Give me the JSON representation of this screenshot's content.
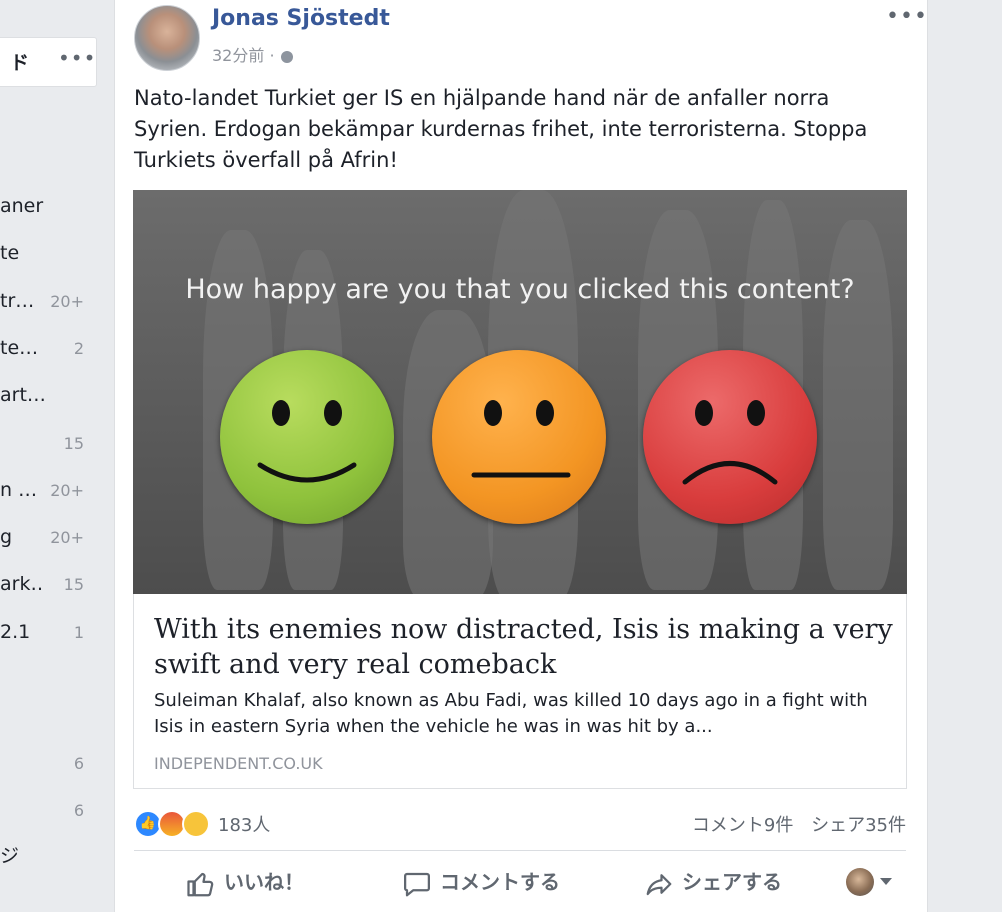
{
  "sidebar": {
    "top_label": "ド",
    "top_menu": "•••",
    "items": [
      {
        "label": "aner",
        "count": ""
      },
      {
        "label": "te",
        "count": ""
      },
      {
        "label": "tr…",
        "count": "20+"
      },
      {
        "label": "te…",
        "count": "2"
      },
      {
        "label": "art…",
        "count": ""
      },
      {
        "label": "",
        "count": "15"
      },
      {
        "label": "n …",
        "count": "20+"
      },
      {
        "label": "g",
        "count": "20+"
      },
      {
        "label": "ark…",
        "count": "15"
      },
      {
        "label": "2.1",
        "count": "1"
      },
      {
        "label": "",
        "count": "6"
      },
      {
        "label": "",
        "count": "6"
      },
      {
        "label": "ジ",
        "count": ""
      }
    ]
  },
  "post": {
    "author": "Jonas Sjöstedt",
    "time": "32分前 ·",
    "menu": "•••",
    "text": "Nato-landet Turkiet ger IS en hjälpande hand när de anfaller norra Syrien. Erdogan bekämpar kurdernas frihet, inte terroristerna. Stoppa Turkiets överfall på Afrin!",
    "image_question": "How happy are you that you clicked this content?",
    "link": {
      "headline": "With its enemies now distracted, Isis is making a very swift and very real comeback",
      "description": "Suleiman Khalaf, also known as Abu Fadi, was killed 10 days ago in a fight with Isis in eastern Syria when the vehicle he was in was hit by a...",
      "domain": "INDEPENDENT.CO.UK"
    },
    "reactions": {
      "count": "183人",
      "comments": "コメント9件",
      "shares": "シェア35件"
    },
    "actions": {
      "like": "いいね！",
      "comment": "コメントする",
      "share": "シェアする"
    }
  }
}
